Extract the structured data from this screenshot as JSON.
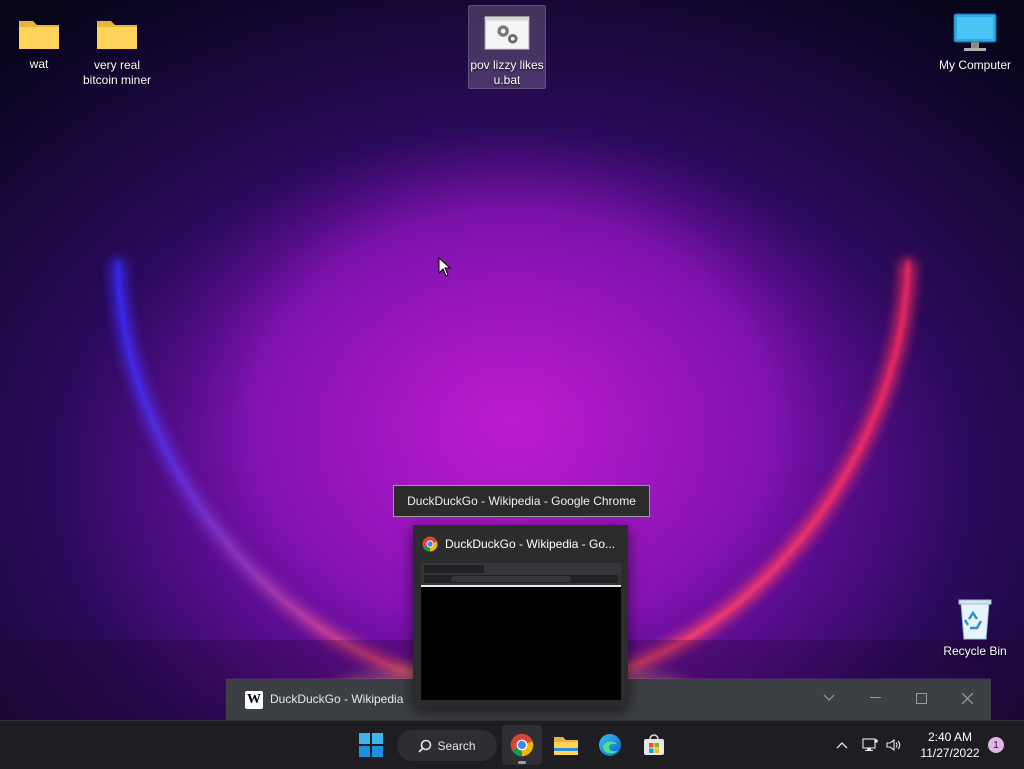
{
  "desktop_icons": [
    {
      "name": "wat",
      "icon": "folder-icon"
    },
    {
      "name": "very real\nbitcoin miner",
      "icon": "folder-icon"
    },
    {
      "name": "pov lizzy likes\nu.bat",
      "icon": "batch-file-icon",
      "selected": true
    },
    {
      "name": "My Computer",
      "icon": "monitor-icon"
    },
    {
      "name": "Recycle Bin",
      "icon": "recycle-bin-icon"
    }
  ],
  "tooltip": "DuckDuckGo - Wikipedia - Google Chrome",
  "preview": {
    "title": "DuckDuckGo - Wikipedia - Go...",
    "icon": "chrome-icon"
  },
  "window": {
    "title": "DuckDuckGo - Wikipedia",
    "icon": "wikipedia-icon"
  },
  "taskbar": {
    "search_label": "Search",
    "apps": [
      "start-icon",
      "chrome-icon",
      "file-explorer-icon",
      "edge-icon",
      "store-icon"
    ]
  },
  "clock": {
    "time": "2:40 AM",
    "date": "11/27/2022"
  },
  "notifications": {
    "count": "1"
  },
  "colors": {
    "taskbar": "#1d1d22",
    "glow_pink": "#ff3c6e",
    "glow_purple": "#a020c8"
  }
}
